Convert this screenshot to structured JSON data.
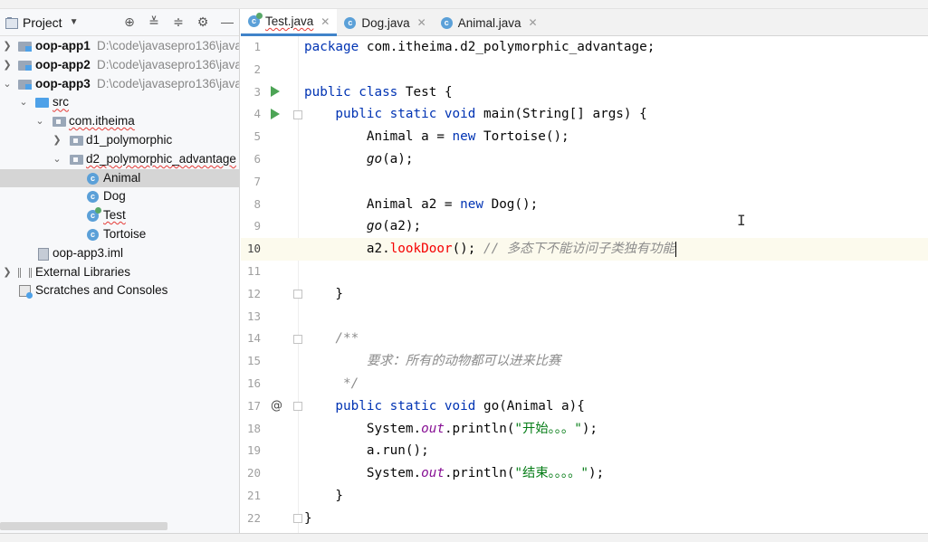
{
  "project_panel": {
    "title": "Project",
    "tree": [
      {
        "name": "oop-app1",
        "path": "D:\\code\\javasepro136\\java",
        "type": "module"
      },
      {
        "name": "oop-app2",
        "path": "D:\\code\\javasepro136\\java",
        "type": "module"
      },
      {
        "name": "oop-app3",
        "path": "D:\\code\\javasepro136\\java",
        "type": "module"
      },
      {
        "name": "src",
        "type": "source-folder"
      },
      {
        "name": "com.itheima",
        "type": "package"
      },
      {
        "name": "d1_polymorphic",
        "type": "package"
      },
      {
        "name": "d2_polymorphic_advantage",
        "type": "package"
      },
      {
        "name": "Animal",
        "type": "class",
        "selected": true
      },
      {
        "name": "Dog",
        "type": "class"
      },
      {
        "name": "Test",
        "type": "class"
      },
      {
        "name": "Tortoise",
        "type": "class"
      },
      {
        "name": "oop-app3.iml",
        "type": "iml"
      },
      {
        "name": "External Libraries",
        "type": "libraries"
      },
      {
        "name": "Scratches and Consoles",
        "type": "scratches"
      }
    ]
  },
  "tabs": [
    {
      "label": "Test.java",
      "active": true
    },
    {
      "label": "Dog.java",
      "active": false
    },
    {
      "label": "Animal.java",
      "active": false
    }
  ],
  "editor": {
    "current_line": 10,
    "line_numbers": [
      "1",
      "2",
      "3",
      "4",
      "5",
      "6",
      "7",
      "8",
      "9",
      "10",
      "11",
      "12",
      "13",
      "14",
      "15",
      "16",
      "17",
      "18",
      "19",
      "20",
      "21",
      "22"
    ],
    "code": {
      "l1_kw": "package",
      "l1_rest": " com.itheima.d2_polymorphic_advantage;",
      "l3_kw": "public class",
      "l3_rest": " Test {",
      "l4_kw": "    public static void",
      "l4_rest": " main(String[] args) {",
      "l5_a": "        Animal a = ",
      "l5_kw": "new",
      "l5_b": " Tortoise();",
      "l6_m": "        go",
      "l6_b": "(a);",
      "l8_a": "        Animal a2 = ",
      "l8_kw": "new",
      "l8_b": " Dog();",
      "l9_m": "        go",
      "l9_b": "(a2);",
      "l10_a": "        a2.",
      "l10_err": "lookDoor",
      "l10_b": "(); ",
      "l10_cm": "// 多态下不能访问子类独有功能",
      "l12": "    }",
      "l14": "    /**",
      "l15": "        要求：所有的动物都可以进来比赛",
      "l16": "     */",
      "l17_kw": "    public static void",
      "l17_rest": " go(Animal a){",
      "l18_a": "        System.",
      "l18_f": "out",
      "l18_b": ".println(",
      "l18_s": "\"开始。。。\"",
      "l18_c": ");",
      "l19": "        a.run();",
      "l20_a": "        System.",
      "l20_f": "out",
      "l20_b": ".println(",
      "l20_s": "\"结束。。。。\"",
      "l20_c": ");",
      "l21": "    }",
      "l22": "}"
    },
    "gutter_markers": {
      "run_line_3": "run",
      "run_line_4": "run",
      "at_line_17": "@"
    }
  },
  "colors": {
    "keyword": "#0033b3",
    "comment": "#8c8c8c",
    "string": "#067d17",
    "static_field": "#871094",
    "error": "#f50000",
    "current_line": "#fcfaed",
    "selection": "#d5d5d5",
    "tab_underline": "#4083c9"
  }
}
